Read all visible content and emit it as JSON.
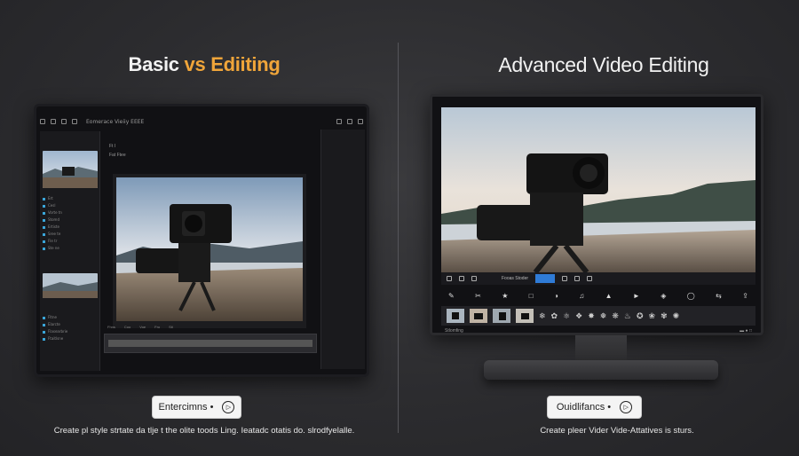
{
  "left": {
    "title_part1": "Basic",
    "title_part2": "vs Ediiting",
    "menu_label": "Eomerace Vieiiy EEEE",
    "tracks": [
      "Ft I",
      "Fat  Ftee"
    ],
    "panel_rows": [
      "Ert",
      "Cesl",
      "Vorte tn",
      "Stomd",
      "Ertiste",
      "Sree te",
      "Fle tr",
      "Ste ne"
    ],
    "panel_rows_b": [
      "Fltne",
      "Elarcte",
      "Flasearbrie",
      "Ftaitlsne"
    ],
    "timeline_labels": [
      "Fhns",
      "Coo",
      "Voe",
      "Fro",
      "Sti"
    ],
    "cta_label": "Entercimns •",
    "caption": "Create pl style strtate da tlje t the olite toods Ling. Ieatadc otatis do. slrodfyelalle."
  },
  "right": {
    "title": "Advanced Video Editing",
    "toolbar_label": "Fooas Stoder",
    "status_label": "Stlomfing",
    "cta_label": "Ouidlifancs •",
    "caption": "Create pleer Vider Vide-Attatives is sturs."
  }
}
